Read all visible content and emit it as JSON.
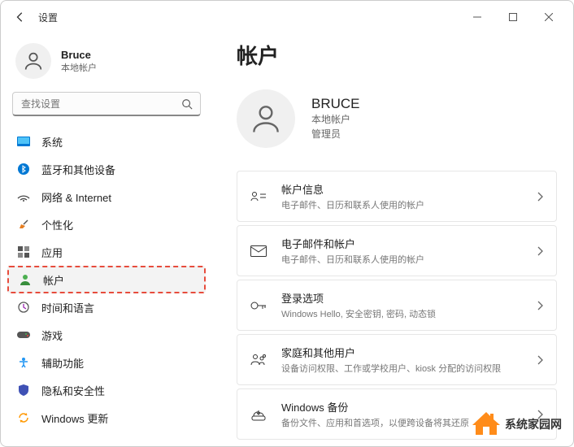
{
  "titlebar": {
    "title": "设置"
  },
  "sidebar": {
    "user": {
      "name": "Bruce",
      "sub": "本地帐户"
    },
    "search": {
      "placeholder": "查找设置"
    },
    "items": [
      {
        "label": "系统"
      },
      {
        "label": "蓝牙和其他设备"
      },
      {
        "label": "网络 & Internet"
      },
      {
        "label": "个性化"
      },
      {
        "label": "应用"
      },
      {
        "label": "帐户"
      },
      {
        "label": "时间和语言"
      },
      {
        "label": "游戏"
      },
      {
        "label": "辅助功能"
      },
      {
        "label": "隐私和安全性"
      },
      {
        "label": "Windows 更新"
      }
    ]
  },
  "main": {
    "title": "帐户",
    "profile": {
      "name": "BRUCE",
      "sub1": "本地帐户",
      "sub2": "管理员"
    },
    "cards": [
      {
        "title": "帐户信息",
        "desc": "电子邮件、日历和联系人使用的帐户"
      },
      {
        "title": "电子邮件和帐户",
        "desc": "电子邮件、日历和联系人使用的帐户"
      },
      {
        "title": "登录选项",
        "desc": "Windows Hello, 安全密钥, 密码, 动态锁"
      },
      {
        "title": "家庭和其他用户",
        "desc": "设备访问权限、工作或学校用户、kiosk 分配的访问权限"
      },
      {
        "title": "Windows 备份",
        "desc": "备份文件、应用和首选项，以便跨设备将其还原"
      }
    ]
  },
  "watermark": {
    "text": "系统家园网"
  }
}
